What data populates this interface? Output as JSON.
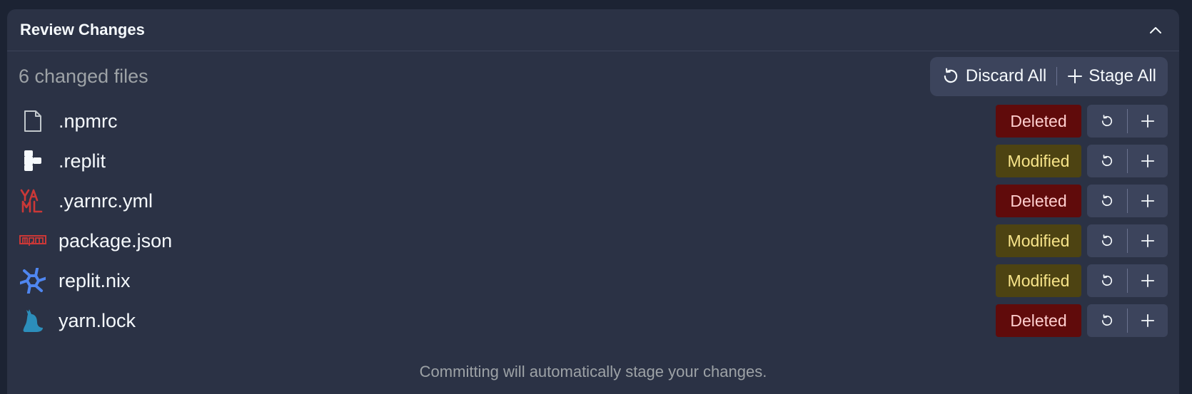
{
  "panel": {
    "title": "Review Changes",
    "collapse_icon": "chevron-up-icon"
  },
  "summary": {
    "changed_files": "6 changed files",
    "discard_all_label": "Discard All",
    "stage_all_label": "Stage All"
  },
  "files": [
    {
      "name": ".npmrc",
      "icon": "file-icon",
      "status": "Deleted"
    },
    {
      "name": ".replit",
      "icon": "replit-icon",
      "status": "Modified"
    },
    {
      "name": ".yarnrc.yml",
      "icon": "yaml-icon",
      "status": "Deleted"
    },
    {
      "name": "package.json",
      "icon": "npm-icon",
      "status": "Modified"
    },
    {
      "name": "replit.nix",
      "icon": "nix-icon",
      "status": "Modified"
    },
    {
      "name": "yarn.lock",
      "icon": "yarn-icon",
      "status": "Deleted"
    }
  ],
  "footer": {
    "note": "Committing will automatically stage your changes."
  },
  "colors": {
    "background": "#1c2333",
    "panel": "#2b3245",
    "deleted_bg": "#600b0b",
    "deleted_text": "#ffcfcf",
    "modified_bg": "#4d4312",
    "modified_text": "#f8e58a",
    "yaml": "#cb3837",
    "npm": "#cb3837",
    "nix": "#4f86f0",
    "yarn": "#2c8ebb"
  }
}
